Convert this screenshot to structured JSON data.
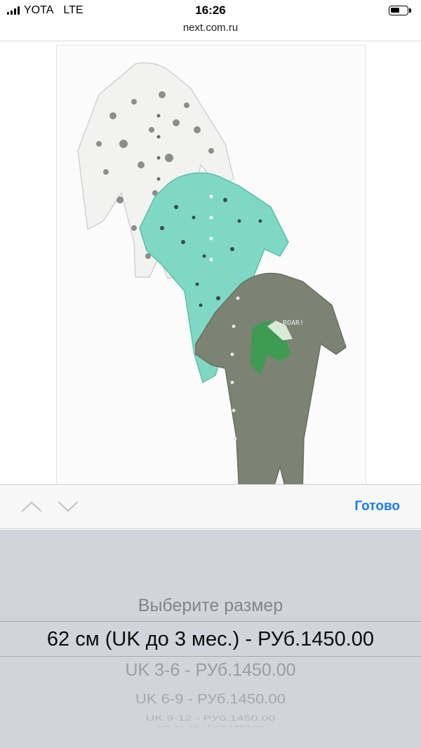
{
  "status_bar": {
    "carrier": "YOTA",
    "network": "LTE",
    "time": "16:26",
    "battery_level": 0.55
  },
  "browser": {
    "url": "next.com.ru"
  },
  "product": {
    "image_icon": "baby-sleepsuits-image"
  },
  "toolbar": {
    "prev_icon": "chevron-up-icon",
    "next_icon": "chevron-down-icon",
    "done_label": "Готово",
    "accent_color": "#1a7cf0"
  },
  "size_picker": {
    "placeholder": "Выберите размер",
    "selected": "62 см (UK до 3 мес.) - РУб.1450.00",
    "options": [
      "UK 3-6 - РУб.1450.00",
      "UK 6-9 - РУб.1450.00",
      "UK 9-12 - РУб.1450.00",
      "UK 12-18 - РУб.1450.00"
    ]
  }
}
